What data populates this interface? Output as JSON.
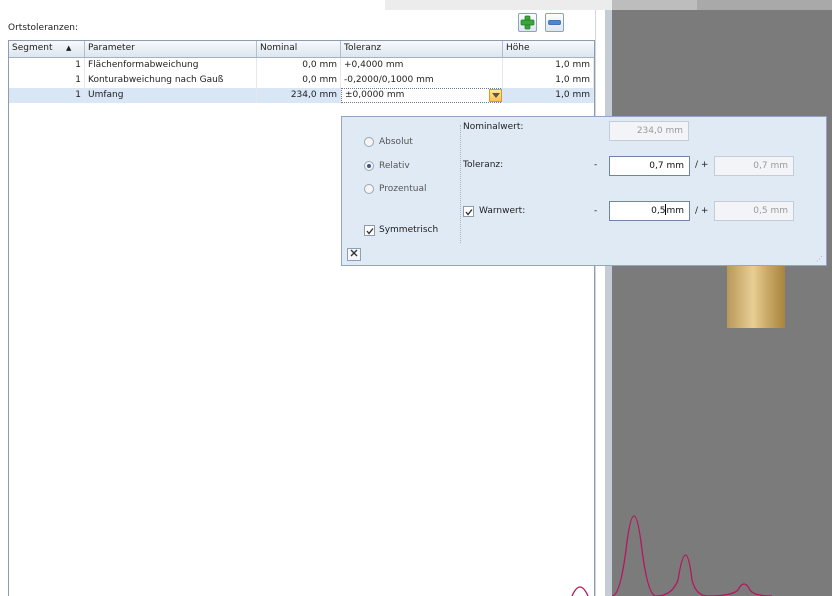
{
  "panel": {
    "title": "Ortstoleranzen:"
  },
  "toolbar": {
    "add_icon": "plus-icon",
    "remove_icon": "minus-icon"
  },
  "grid": {
    "columns": [
      "Segment",
      "Parameter",
      "Nominal",
      "Toleranz",
      "Höhe"
    ],
    "sort_indicator": "▲",
    "rows": [
      {
        "segment": "1",
        "parameter": "Flächenformabweichung",
        "nominal": "0,0 mm",
        "toleranz": "+0,4000 mm",
        "hoehe": "1,0 mm"
      },
      {
        "segment": "1",
        "parameter": "Konturabweichung nach Gauß",
        "nominal": "0,0 mm",
        "toleranz": "-0,2000/0,1000 mm",
        "hoehe": "1,0 mm"
      },
      {
        "segment": "1",
        "parameter": "Umfang",
        "nominal": "234,0 mm",
        "toleranz": "±0,0000 mm",
        "hoehe": "1,0 mm"
      }
    ]
  },
  "popup": {
    "modes": [
      "Absolut",
      "Relativ",
      "Prozentual"
    ],
    "selected_mode": "Relativ",
    "symmetrisch_label": "Symmetrisch",
    "symmetrisch_checked": true,
    "nominal_label": "Nominalwert:",
    "nominal_value": "234,0 mm",
    "toleranz_label": "Toleranz:",
    "toleranz_minus_sign": "-",
    "toleranz_minus": "0,7 mm",
    "toleranz_plus_sign": "/ +",
    "toleranz_plus": "0,7 mm",
    "warn_label": "Warnwert:",
    "warn_checked": true,
    "warn_minus_sign": "-",
    "warn_minus_number": "0,5",
    "warn_minus_unit": "mm",
    "warn_plus_sign": "/ +",
    "warn_plus": "0,5 mm",
    "close_icon": "close-icon"
  },
  "colors": {
    "selection": "#d8e6f5",
    "popup_bg": "#e0eaf5",
    "plot_curve": "#b4175e",
    "viewer_bg": "#7b7b7b"
  }
}
